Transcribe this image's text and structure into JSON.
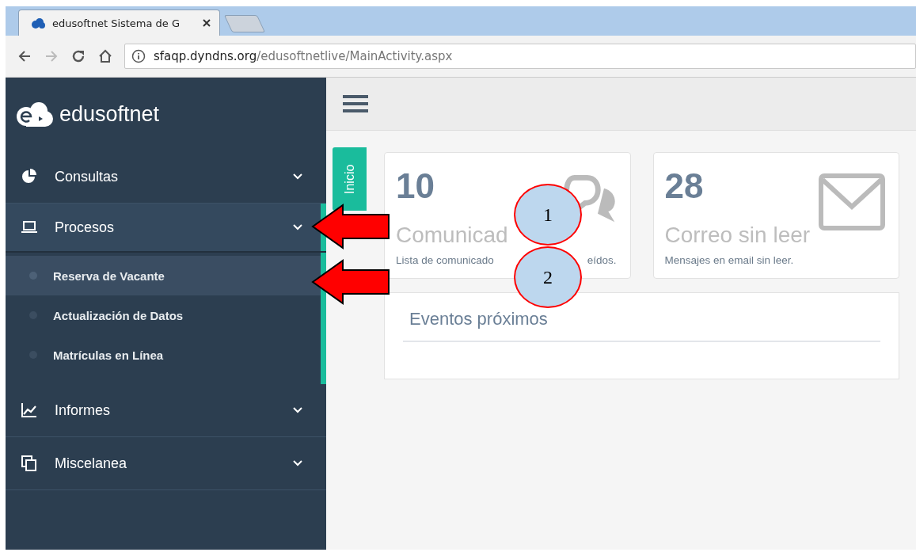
{
  "browser": {
    "tabs": [
      {
        "title": "edusoftnet Sistema de G",
        "selected": true
      }
    ],
    "address": {
      "host": "sfaqp.dyndns.org",
      "path": "/edusoftnetlive/MainActivity.aspx"
    }
  },
  "sidebar": {
    "brand": "edusoftnet",
    "items": [
      {
        "label": "Consultas",
        "expanded": false
      },
      {
        "label": "Procesos",
        "expanded": true,
        "children": [
          {
            "label": "Reserva de Vacante",
            "selected": true
          },
          {
            "label": "Actualización de Datos",
            "selected": false
          },
          {
            "label": "Matrículas en Línea",
            "selected": false
          }
        ]
      },
      {
        "label": "Informes",
        "expanded": false
      },
      {
        "label": "Miscelanea",
        "expanded": false
      }
    ]
  },
  "main": {
    "side_tab": "Inicio",
    "cards": [
      {
        "value": "10",
        "title": "Comunicad",
        "description": [
          "Lista de comunicado",
          "eídos."
        ]
      },
      {
        "value": "28",
        "title": "Correo sin leer",
        "description": [
          "Mensajes en email sin leer."
        ]
      }
    ],
    "events": {
      "title": "Eventos próximos"
    }
  },
  "annotations": [
    {
      "label": "1"
    },
    {
      "label": "2"
    }
  ]
}
